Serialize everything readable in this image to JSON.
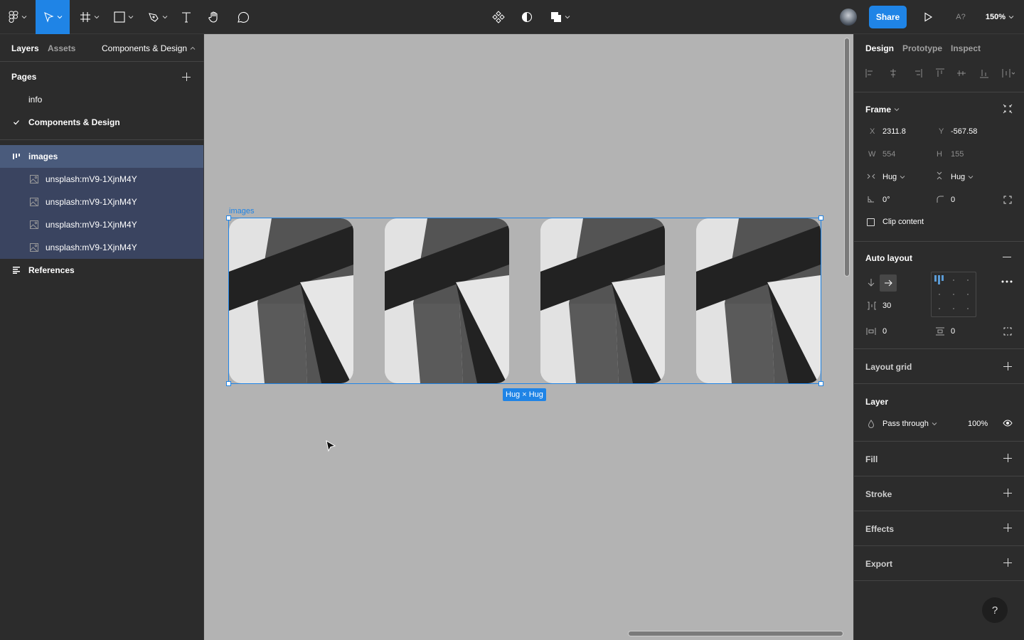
{
  "toolbar": {
    "tools": [
      {
        "name": "main-menu",
        "icon": "figma-logo-icon"
      },
      {
        "name": "move-tool",
        "icon": "cursor-arrow-icon",
        "active": true
      },
      {
        "name": "frame-tool",
        "icon": "frame-hash-icon"
      },
      {
        "name": "shape-tool",
        "icon": "rectangle-icon"
      },
      {
        "name": "pen-tool",
        "icon": "pen-icon"
      },
      {
        "name": "text-tool",
        "icon": "text-icon",
        "glyph": "T"
      },
      {
        "name": "hand-tool",
        "icon": "hand-icon"
      },
      {
        "name": "comment-tool",
        "icon": "comment-icon"
      }
    ],
    "center_tools": [
      {
        "name": "components",
        "icon": "component-icon"
      },
      {
        "name": "mask",
        "icon": "contrast-icon"
      },
      {
        "name": "boolean",
        "icon": "boolean-union-icon"
      }
    ],
    "share_label": "Share",
    "present_icon": "play-icon",
    "font_check_label": "A?",
    "zoom_label": "150%",
    "accent_color": "#1f84e6"
  },
  "left_panel": {
    "tabs": {
      "layers": "Layers",
      "assets": "Assets"
    },
    "current_page_dropdown": "Components & Design",
    "pages_title": "Pages",
    "pages": [
      {
        "label": "info",
        "selected": false
      },
      {
        "label": "Components & Design",
        "selected": true
      }
    ],
    "layers": [
      {
        "label": "images",
        "type": "auto-layout-frame",
        "selected": true,
        "indent": 0
      },
      {
        "label": "unsplash:mV9-1XjnM4Y",
        "type": "image",
        "selected": true,
        "indent": 1
      },
      {
        "label": "unsplash:mV9-1XjnM4Y",
        "type": "image",
        "selected": true,
        "indent": 1
      },
      {
        "label": "unsplash:mV9-1XjnM4Y",
        "type": "image",
        "selected": true,
        "indent": 1
      },
      {
        "label": "unsplash:mV9-1XjnM4Y",
        "type": "image",
        "selected": true,
        "indent": 1
      },
      {
        "label": "References",
        "type": "text-frame",
        "selected": false,
        "indent": 0
      }
    ]
  },
  "canvas": {
    "frame_label": "images",
    "size_badge": "Hug × Hug",
    "image_count": 4
  },
  "right_panel": {
    "tabs": {
      "design": "Design",
      "prototype": "Prototype",
      "inspect": "Inspect"
    },
    "frame": {
      "title": "Frame",
      "x_label": "X",
      "x": "2311.8",
      "y_label": "Y",
      "y": "-567.58",
      "w_label": "W",
      "w": "554",
      "h_label": "H",
      "h": "155",
      "width_mode": "Hug",
      "height_mode": "Hug",
      "rotation": "0°",
      "corner_radius": "0",
      "clip_content_label": "Clip content",
      "clip_content": false
    },
    "auto_layout": {
      "title": "Auto layout",
      "direction": "horizontal",
      "spacing": "30",
      "padding_horizontal": "0",
      "padding_vertical": "0"
    },
    "layout_grid": {
      "title": "Layout grid"
    },
    "layer": {
      "title": "Layer",
      "blend_mode": "Pass through",
      "opacity": "100%"
    },
    "fill": {
      "title": "Fill"
    },
    "stroke": {
      "title": "Stroke"
    },
    "effects": {
      "title": "Effects"
    },
    "export": {
      "title": "Export"
    },
    "help_label": "?"
  }
}
